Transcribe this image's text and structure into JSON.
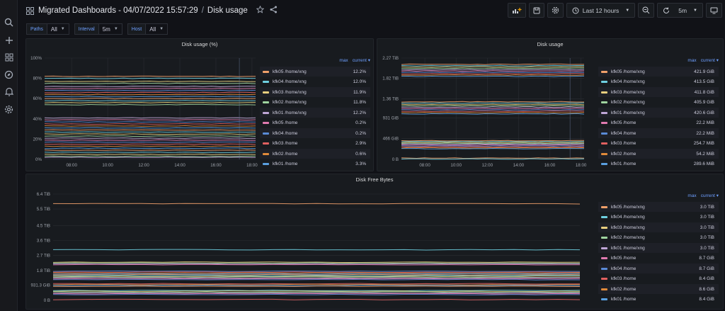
{
  "dashboard": {
    "title": "Migrated Dashboards - 04/07/2022 15:57:29",
    "separator": "/",
    "page": "Disk usage",
    "time_range": "Last 12 hours",
    "refresh_interval": "5m"
  },
  "variables": [
    {
      "label": "Paths",
      "value": "All"
    },
    {
      "label": "Interval",
      "value": "5m"
    },
    {
      "label": "Host",
      "value": "All"
    }
  ],
  "colors": {
    "series": [
      "#f0a06a",
      "#6ed0e0",
      "#e8cf7e",
      "#9fd49f",
      "#bfa6d6",
      "#e07ab0",
      "#5a8ad6",
      "#e06060",
      "#e08a3a",
      "#5aa0e0"
    ],
    "accent": "#6e9fff"
  },
  "panels": {
    "disk_usage_pct": {
      "title": "Disk usage (%)",
      "legend_headers": [
        "max",
        "current"
      ],
      "legend": [
        {
          "name": "kfk05 /home/xng",
          "value": "12.2%"
        },
        {
          "name": "kfk04 /home/xng",
          "value": "12.0%"
        },
        {
          "name": "kfk03 /home/xng",
          "value": "11.9%"
        },
        {
          "name": "kfk02 /home/xng",
          "value": "11.8%"
        },
        {
          "name": "kfk01 /home/xng",
          "value": "12.2%"
        },
        {
          "name": "kfk05 /home",
          "value": "0.2%"
        },
        {
          "name": "kfk04 /home",
          "value": "0.2%"
        },
        {
          "name": "kfk03 /home",
          "value": "2.9%"
        },
        {
          "name": "kfk02 /home",
          "value": "0.6%"
        },
        {
          "name": "kfk01 /home",
          "value": "3.3%"
        }
      ]
    },
    "disk_usage": {
      "title": "Disk usage",
      "legend_headers": [
        "max",
        "current"
      ],
      "legend": [
        {
          "name": "kfk05 /home/xng",
          "value": "421.9 GiB"
        },
        {
          "name": "kfk04 /home/xng",
          "value": "413.5 GiB"
        },
        {
          "name": "kfk03 /home/xng",
          "value": "411.8 GiB"
        },
        {
          "name": "kfk02 /home/xng",
          "value": "405.9 GiB"
        },
        {
          "name": "kfk01 /home/xng",
          "value": "420.6 GiB"
        },
        {
          "name": "kfk05 /home",
          "value": "22.2 MiB"
        },
        {
          "name": "kfk04 /home",
          "value": "22.2 MiB"
        },
        {
          "name": "kfk03 /home",
          "value": "254.7 MiB"
        },
        {
          "name": "kfk02 /home",
          "value": "54.2 MiB"
        },
        {
          "name": "kfk01 /home",
          "value": "289.6 MiB"
        }
      ]
    },
    "disk_free": {
      "title": "Disk Free Bytes",
      "legend_headers": [
        "max",
        "current"
      ],
      "legend": [
        {
          "name": "kfk05 /home/xng",
          "value": "3.0 TiB"
        },
        {
          "name": "kfk04 /home/xng",
          "value": "3.0 TiB"
        },
        {
          "name": "kfk03 /home/xng",
          "value": "3.0 TiB"
        },
        {
          "name": "kfk02 /home/xng",
          "value": "3.0 TiB"
        },
        {
          "name": "kfk01 /home/xng",
          "value": "3.0 TiB"
        },
        {
          "name": "kfk05 /home",
          "value": "8.7 GiB"
        },
        {
          "name": "kfk04 /home",
          "value": "8.7 GiB"
        },
        {
          "name": "kfk03 /home",
          "value": "8.4 GiB"
        },
        {
          "name": "kfk02 /home",
          "value": "8.6 GiB"
        },
        {
          "name": "kfk01 /home",
          "value": "8.4 GiB"
        }
      ]
    }
  },
  "chart_data": [
    {
      "type": "line",
      "title": "Disk usage (%)",
      "y_tick_labels": [
        "100%",
        "80%",
        "60%",
        "40%",
        "20%",
        "0%"
      ],
      "x_tick_labels": [
        "08:00",
        "10:00",
        "12:00",
        "14:00",
        "16:00",
        "18:00"
      ],
      "ylim": [
        0,
        100
      ],
      "x_domain": [
        6.5,
        18.2
      ],
      "series_levels": [
        82,
        80,
        77,
        75,
        72,
        70,
        68,
        66,
        64,
        62,
        60,
        58,
        56,
        54,
        41,
        39,
        37,
        35,
        33,
        31,
        29,
        27,
        25,
        23,
        21,
        19,
        17,
        15,
        13,
        11,
        9,
        7,
        5,
        3,
        2
      ]
    },
    {
      "type": "line",
      "title": "Disk usage",
      "y_tick_labels": [
        "2.27 TiB",
        "1.82 TiB",
        "1.36 TiB",
        "931 GiB",
        "466 GiB",
        "0 B"
      ],
      "y_tick_values": [
        2270,
        1820,
        1360,
        931,
        466,
        0
      ],
      "y_unit": "GiB",
      "x_tick_labels": [
        "08:00",
        "10:00",
        "12:00",
        "14:00",
        "16:00",
        "18:00"
      ],
      "ylim": [
        0,
        2270
      ],
      "x_domain": [
        6.5,
        18.2
      ],
      "series_levels": [
        2130,
        2100,
        2070,
        2040,
        2010,
        1980,
        1950,
        1920,
        1890,
        1860,
        1290,
        1260,
        1230,
        1200,
        1170,
        1140,
        1110,
        1080,
        1050,
        1020,
        420,
        400,
        380,
        360,
        340,
        320,
        300,
        280,
        260,
        240,
        30,
        10
      ]
    },
    {
      "type": "line",
      "title": "Disk Free Bytes",
      "y_tick_labels": [
        "6.4 TiB",
        "5.5 TiB",
        "4.5 TiB",
        "3.6 TiB",
        "2.7 TiB",
        "1.8 TiB",
        "931.3 GiB",
        "0 B"
      ],
      "y_tick_values": [
        6.4,
        5.5,
        4.5,
        3.6,
        2.7,
        1.8,
        0.9095,
        0
      ],
      "y_unit": "TiB",
      "ylim": [
        0,
        6.4
      ],
      "series_levels": [
        5.82,
        3.05,
        2.3,
        2.25,
        2.2,
        2.15,
        1.75,
        1.7,
        1.65,
        1.6,
        1.55,
        1.5,
        1.45,
        1.4,
        1.35,
        1.3,
        1.25,
        1.0,
        0.95,
        0.9,
        0.85,
        0.6,
        0.55,
        0.5,
        0.45,
        0.4,
        0.35,
        0.05
      ]
    }
  ]
}
